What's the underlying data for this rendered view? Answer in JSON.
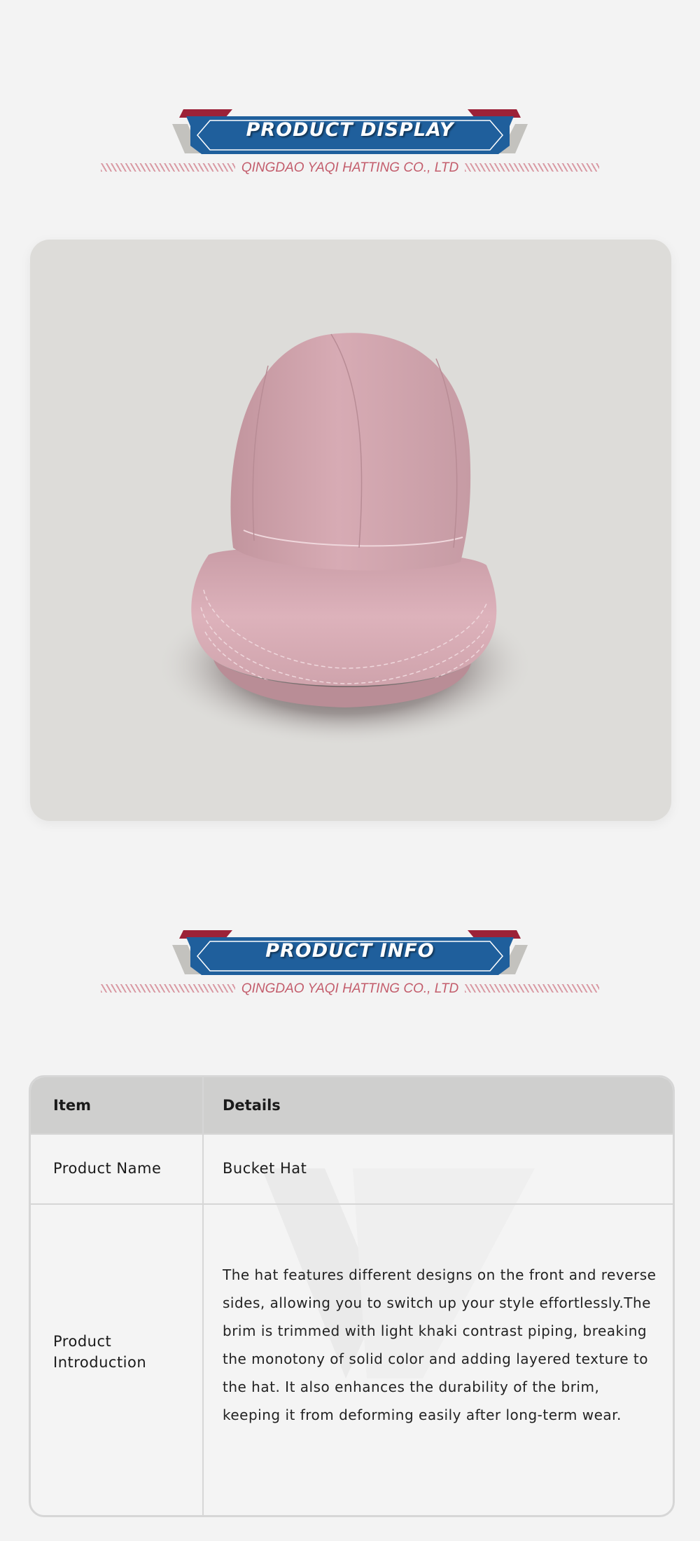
{
  "section_display": {
    "title": "PRODUCT DISPLAY",
    "subtitle": "QINGDAO YAQI HATTING CO., LTD"
  },
  "product_image": {
    "subject": "pink bucket hat",
    "background": "#dddcd9",
    "hat_color": "#d7a9b2"
  },
  "section_info": {
    "title": "PRODUCT INFO",
    "subtitle": "QINGDAO YAQI HATTING CO., LTD"
  },
  "table": {
    "headers": [
      "Item",
      "Details"
    ],
    "rows": [
      {
        "item": "Product Name",
        "details": "Bucket Hat"
      },
      {
        "item": "Product Introduction",
        "details": "The hat features different designs on the front and reverse sides, allowing you to switch up your style effortlessly.The brim is trimmed with light khaki contrast piping, breaking the monotony of solid color and adding layered texture to the hat. It also enhances the durability of the brim, keeping it from deforming easily after long-term wear."
      }
    ]
  },
  "colors": {
    "banner_blue": "#1f5f9c",
    "banner_red": "#9c2238",
    "banner_gray": "#c3c2be",
    "subtitle_pink": "#c35d6c",
    "page_bg": "#f3f3f3"
  }
}
